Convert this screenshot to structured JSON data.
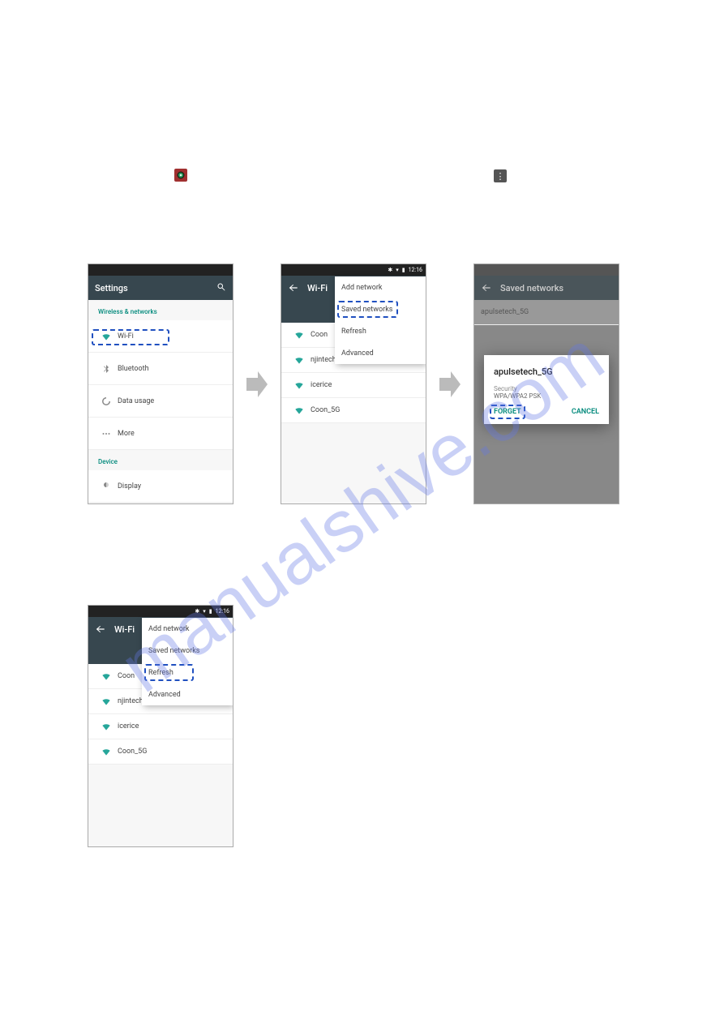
{
  "inline_icons": {
    "settings_label": "settings app icon",
    "vdots_label": "⋮"
  },
  "screen1": {
    "title": "Settings",
    "section_wn": "Wireless & networks",
    "items": [
      {
        "label": "Wi-Fi"
      },
      {
        "label": "Bluetooth"
      },
      {
        "label": "Data usage"
      },
      {
        "label": "More"
      }
    ],
    "section_device": "Device",
    "device_items": [
      {
        "label": "Display"
      }
    ]
  },
  "screen2": {
    "time": "12:16",
    "title": "Wi-Fi",
    "toggle": "On",
    "menu": [
      {
        "label": "Add network"
      },
      {
        "label": "Saved networks"
      },
      {
        "label": "Refresh"
      },
      {
        "label": "Advanced"
      }
    ],
    "networks": [
      {
        "label": "Coon"
      },
      {
        "label": "njintech's Home"
      },
      {
        "label": "icerice"
      },
      {
        "label": "Coon_5G"
      }
    ]
  },
  "screen3": {
    "title": "Saved networks",
    "saved": [
      {
        "label": "apulsetech_5G"
      }
    ],
    "dialog": {
      "title": "apulsetech_5G",
      "sec_label": "Security",
      "sec_value": "WPA/WPA2 PSK",
      "forget": "FORGET",
      "cancel": "CANCEL"
    }
  },
  "screen4": {
    "time": "12:16",
    "title": "Wi-Fi",
    "toggle": "On",
    "menu": [
      {
        "label": "Add network"
      },
      {
        "label": "Saved networks"
      },
      {
        "label": "Refresh"
      },
      {
        "label": "Advanced"
      }
    ],
    "networks": [
      {
        "label": "Coon"
      },
      {
        "label": "njintech's Home"
      },
      {
        "label": "icerice"
      },
      {
        "label": "Coon_5G"
      }
    ]
  }
}
